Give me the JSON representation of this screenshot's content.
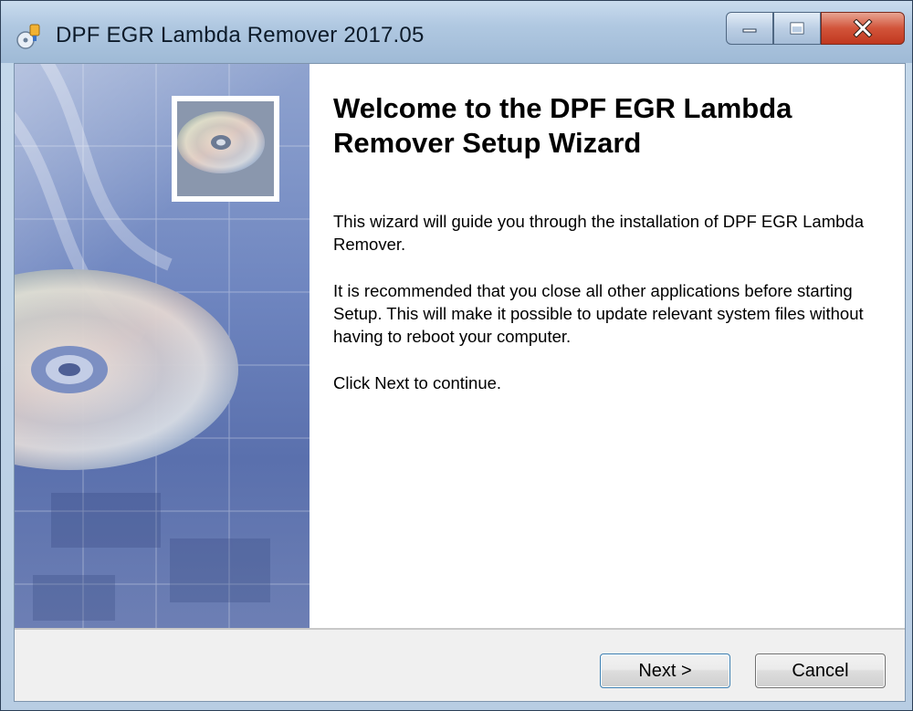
{
  "window": {
    "title": "DPF EGR Lambda Remover 2017.05",
    "icon": "installer-app-icon",
    "caption_buttons": [
      "minimize-icon",
      "maximize-icon",
      "close-icon"
    ]
  },
  "content": {
    "heading": "Welcome to the DPF EGR Lambda Remover Setup Wizard",
    "paragraphs": [
      "This wizard will guide you through the installation of DPF EGR Lambda Remover.",
      "It is recommended that you close all other applications before starting Setup. This will make it possible to update relevant system files without having to reboot your computer.",
      "Click Next to continue."
    ]
  },
  "buttons": {
    "next": "Next >",
    "cancel": "Cancel"
  },
  "colors": {
    "accent_border": "#3c7fb1",
    "close_button": "#c0381f",
    "side_panel": "#6f86c0"
  }
}
